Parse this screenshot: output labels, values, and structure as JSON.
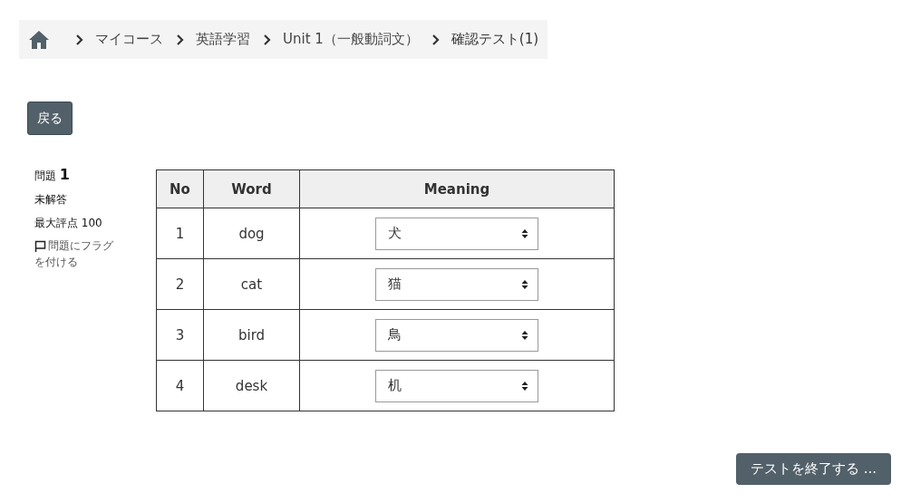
{
  "breadcrumb": [
    "マイコース",
    "英語学習",
    "Unit 1（一般動詞文）",
    "確認テスト(1)"
  ],
  "back_button": "戻る",
  "question_info": {
    "label": "問題",
    "number": "1",
    "status": "未解答",
    "max_grade": "最大評点 100",
    "flag_link": "問題にフラグを付ける",
    "flagged": false
  },
  "table": {
    "columns": [
      "No",
      "Word",
      "Meaning"
    ],
    "rows": [
      {
        "no": "1",
        "word": "dog",
        "meaning": "犬"
      },
      {
        "no": "2",
        "word": "cat",
        "meaning": "猫"
      },
      {
        "no": "3",
        "word": "bird",
        "meaning": "鳥"
      },
      {
        "no": "4",
        "word": "desk",
        "meaning": "机"
      }
    ]
  },
  "finish_button": "テストを終了する ..."
}
